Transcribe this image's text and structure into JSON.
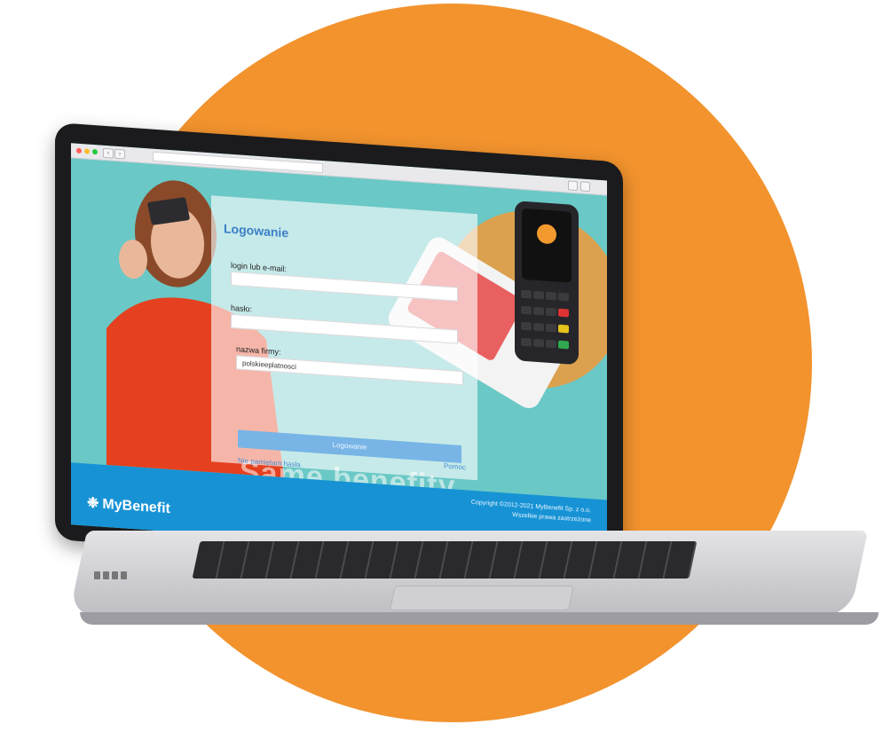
{
  "colors": {
    "circle": "#f2932e",
    "accent": "#3a7fc8",
    "footer": "#1793d5",
    "button": "#78b5e6"
  },
  "browser": {
    "back_icon": "chevron-left-icon",
    "forward_icon": "chevron-right-icon"
  },
  "login": {
    "title": "Logowanie",
    "login_label": "login lub e-mail:",
    "login_value": "",
    "password_label": "hasło:",
    "password_value": "",
    "company_label": "nazwa firmy:",
    "company_value": "polskieeplatnosci",
    "submit_label": "Logowanie",
    "forgot_password": "Nie pamiętam hasła",
    "help": "Pomoc",
    "watermark": "Same benefity"
  },
  "footer": {
    "brand": "MyBenefit",
    "brand_icon": "snowflake-icon",
    "copyright_line1": "Copyright ©2012-2021 MyBenefit Sp. z o.o.",
    "copyright_line2": "Wszelkie prawa zastrzeżone"
  }
}
